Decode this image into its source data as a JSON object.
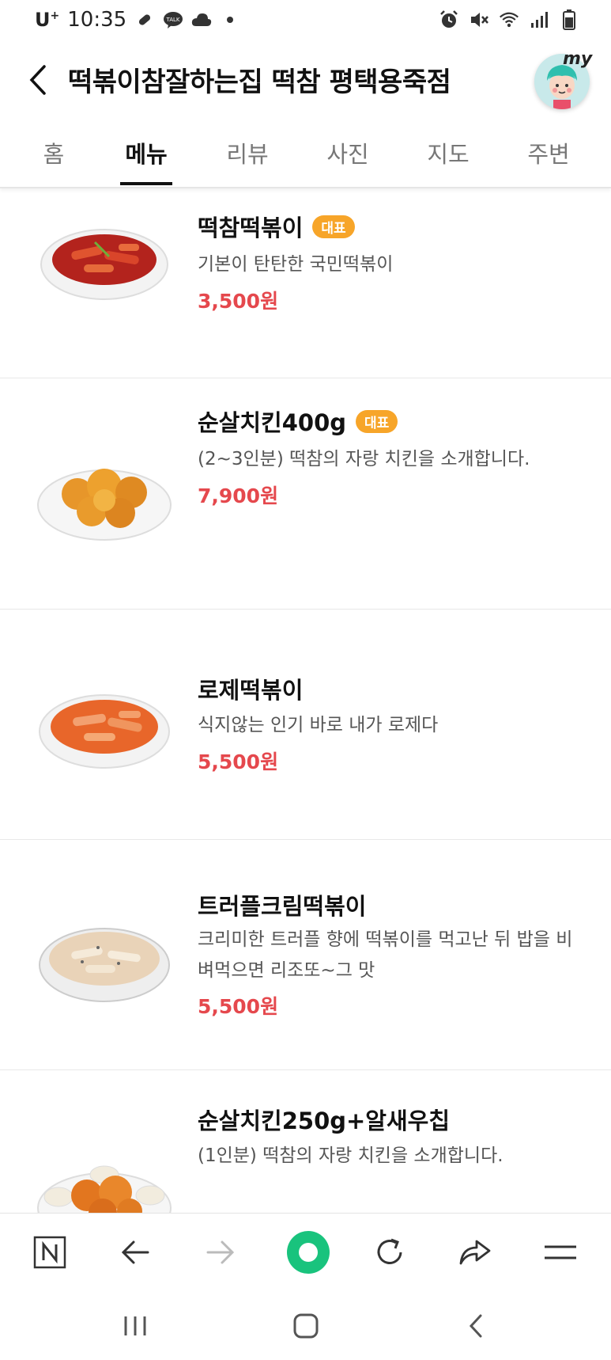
{
  "status_bar": {
    "carrier": "U",
    "carrier_plus": "+",
    "time": "10:35",
    "icons": [
      "pill-icon",
      "kakaotalk-icon",
      "cloud-icon",
      "dot-icon",
      "alarm-icon",
      "mute-icon",
      "wifi-icon",
      "signal-icon",
      "battery-icon"
    ]
  },
  "header": {
    "title": "떡볶이참잘하는집 떡참 평택용죽점",
    "avatar_label": "my"
  },
  "tabs": [
    "홈",
    "메뉴",
    "리뷰",
    "사진",
    "지도",
    "주변"
  ],
  "active_tab": "메뉴",
  "menu": [
    {
      "name": "떡참떡볶이",
      "badge": "대표",
      "description": "기본이 탄탄한 국민떡볶이",
      "price": "3,500원",
      "image": "red-tteokbokki"
    },
    {
      "name": "순살치킨400g",
      "badge": "대표",
      "description": "(2~3인분) 떡참의 자랑 치킨을 소개합니다.",
      "price": "7,900원",
      "image": "fried-chicken"
    },
    {
      "name": "로제떡볶이",
      "badge": "",
      "description": "식지않는 인기 바로 내가 로제다",
      "price": "5,500원",
      "image": "rose-tteokbokki"
    },
    {
      "name": "트러플크림떡볶이",
      "badge": "",
      "description": "크리미한 트러플 향에 떡볶이를 먹고난 뒤 밥을 비벼먹으면 리조또~그 맛",
      "price": "5,500원",
      "image": "cream-tteokbokki"
    },
    {
      "name": "순살치킨250g+알새우칩",
      "badge": "",
      "description": "(1인분) 떡참의 자랑 치킨을 소개합니다.",
      "price": "",
      "image": "chicken-shrimp-chips"
    }
  ],
  "colors": {
    "price": "#e5484d",
    "badge": "#f7a529",
    "active_tab": "#111111",
    "inactive_tab": "#777777",
    "logo_accent": "#19c37d"
  },
  "browser_toolbar": [
    "naver-n-icon",
    "back-arrow-icon",
    "forward-arrow-icon",
    "green-dot-home-icon",
    "refresh-icon",
    "share-icon",
    "menu-icon"
  ],
  "system_nav": [
    "recent-apps-icon",
    "home-icon",
    "back-icon"
  ]
}
